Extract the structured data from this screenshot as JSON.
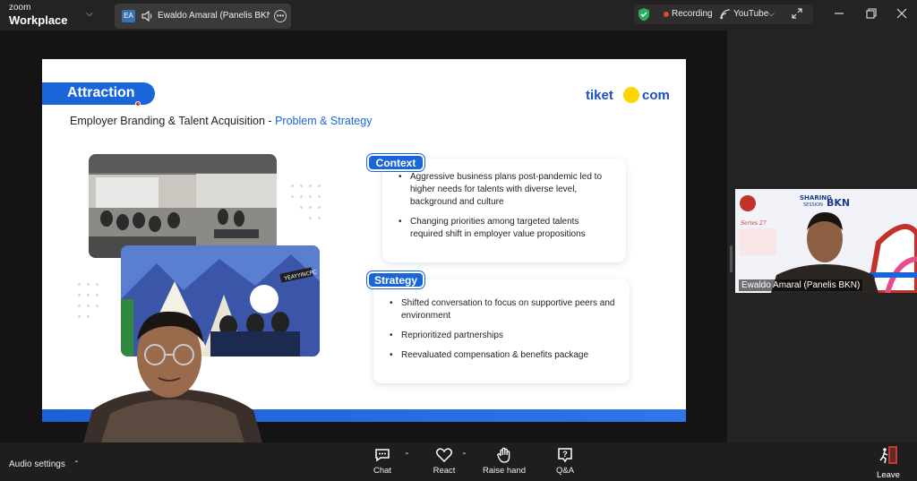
{
  "app": {
    "name_line1": "zoom",
    "name_line2": "Workplace"
  },
  "tab": {
    "avatar": "EA",
    "title": "Ewaldo Amaral (Panelis BKN)'"
  },
  "recording": {
    "status": "Recording",
    "stream": "YouTube"
  },
  "slide": {
    "section": "Attraction",
    "subtitle_main": "Employer Branding & Talent Acquisition - ",
    "subtitle_accent": "Problem & Strategy",
    "logo_left": "tiket",
    "logo_right": "com",
    "photo_sign": "YEAYYINCPC",
    "context": {
      "label": "Context",
      "items": [
        "Aggressive business plans post-pandemic led to higher needs for talents with diverse level, background and culture",
        "Changing priorities among targeted talents required shift in employer value propositions"
      ]
    },
    "strategy": {
      "label": "Strategy",
      "items": [
        "Shifted conversation to focus on supportive peers and environment",
        "Reprioritized partnerships",
        "Reevaluated compensation & benefits package"
      ]
    }
  },
  "participant": {
    "name": "Ewaldo Amaral (Panelis BKN)",
    "banner_sharing": "SHARING",
    "banner_session": "SESSION",
    "banner_bkn": "BKN",
    "banner_series": "Series 27"
  },
  "toolbar": {
    "audio_settings": "Audio settings",
    "chat": "Chat",
    "react": "React",
    "raise_hand": "Raise hand",
    "qa_icon": "?",
    "qa": "Q&A",
    "leave": "Leave"
  },
  "colors": {
    "accent_blue": "#1a66d9",
    "logo_yellow": "#ffd500",
    "record_red": "#e0433a",
    "secure_green": "#27ae60"
  }
}
